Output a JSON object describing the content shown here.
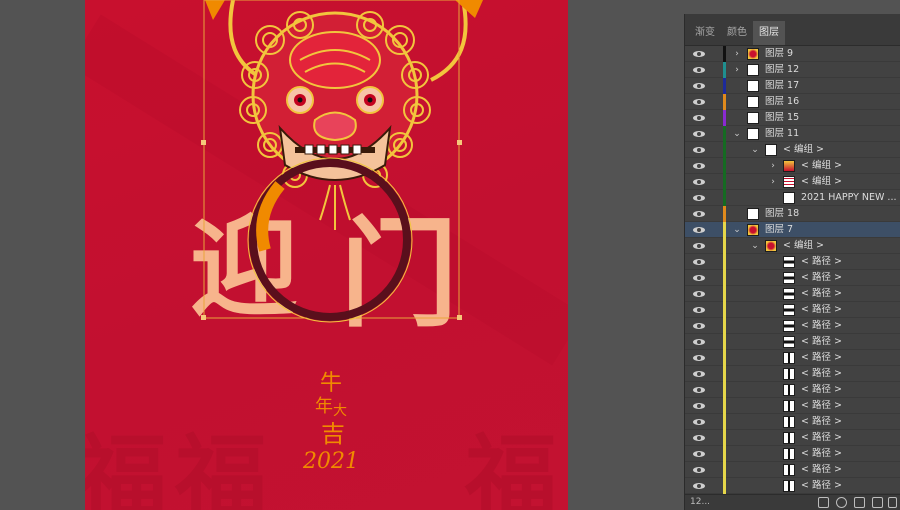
{
  "panel": {
    "tabs": [
      {
        "label": "渐变",
        "active": false
      },
      {
        "label": "颜色",
        "active": false
      },
      {
        "label": "图层",
        "active": true
      }
    ],
    "footer_count": "12..."
  },
  "layers": [
    {
      "name": "图层 9",
      "depth": 0,
      "twisty": "right",
      "color": "#111111",
      "thumb": "art",
      "selected": false
    },
    {
      "name": "图层 12",
      "depth": 0,
      "twisty": "right",
      "color": "#1f8f8f",
      "thumb": "blank",
      "selected": false
    },
    {
      "name": "图层 17",
      "depth": 0,
      "twisty": "",
      "color": "#1d2a9a",
      "thumb": "blank",
      "selected": false
    },
    {
      "name": "图层 16",
      "depth": 0,
      "twisty": "",
      "color": "#e08a1c",
      "thumb": "blank",
      "selected": false
    },
    {
      "name": "图层 15",
      "depth": 0,
      "twisty": "",
      "color": "#8a2ad0",
      "thumb": "blank",
      "selected": false
    },
    {
      "name": "图层 11",
      "depth": 0,
      "twisty": "down",
      "color": "#156b22",
      "thumb": "blank",
      "selected": false
    },
    {
      "name": "< 编组 >",
      "depth": 1,
      "twisty": "down",
      "color": "#156b22",
      "thumb": "blank",
      "selected": false
    },
    {
      "name": "< 编组 >",
      "depth": 2,
      "twisty": "right",
      "color": "#156b22",
      "thumb": "art2",
      "selected": false
    },
    {
      "name": "< 编组 >",
      "depth": 2,
      "twisty": "right",
      "color": "#156b22",
      "thumb": "art3",
      "selected": false
    },
    {
      "name": "2021 HAPPY NEW ...",
      "depth": 2,
      "twisty": "",
      "color": "#156b22",
      "thumb": "blank",
      "selected": false
    },
    {
      "name": "图层 18",
      "depth": 0,
      "twisty": "",
      "color": "#e08a1c",
      "thumb": "blank",
      "selected": false
    },
    {
      "name": "图层 7",
      "depth": 0,
      "twisty": "down",
      "color": "#e6d74a",
      "thumb": "art",
      "selected": true
    },
    {
      "name": "< 编组 >",
      "depth": 1,
      "twisty": "down",
      "color": "#e6d74a",
      "thumb": "art",
      "selected": false
    },
    {
      "name": "< 路径 >",
      "depth": 2,
      "twisty": "",
      "color": "#e6d74a",
      "thumb": "bar",
      "selected": false
    },
    {
      "name": "< 路径 >",
      "depth": 2,
      "twisty": "",
      "color": "#e6d74a",
      "thumb": "bar",
      "selected": false
    },
    {
      "name": "< 路径 >",
      "depth": 2,
      "twisty": "",
      "color": "#e6d74a",
      "thumb": "bar",
      "selected": false
    },
    {
      "name": "< 路径 >",
      "depth": 2,
      "twisty": "",
      "color": "#e6d74a",
      "thumb": "bar",
      "selected": false
    },
    {
      "name": "< 路径 >",
      "depth": 2,
      "twisty": "",
      "color": "#e6d74a",
      "thumb": "bar",
      "selected": false
    },
    {
      "name": "< 路径 >",
      "depth": 2,
      "twisty": "",
      "color": "#e6d74a",
      "thumb": "bar",
      "selected": false
    },
    {
      "name": "< 路径 >",
      "depth": 2,
      "twisty": "",
      "color": "#e6d74a",
      "thumb": "vbar",
      "selected": false
    },
    {
      "name": "< 路径 >",
      "depth": 2,
      "twisty": "",
      "color": "#e6d74a",
      "thumb": "vbar",
      "selected": false
    },
    {
      "name": "< 路径 >",
      "depth": 2,
      "twisty": "",
      "color": "#e6d74a",
      "thumb": "vbar",
      "selected": false
    },
    {
      "name": "< 路径 >",
      "depth": 2,
      "twisty": "",
      "color": "#e6d74a",
      "thumb": "vbar",
      "selected": false
    },
    {
      "name": "< 路径 >",
      "depth": 2,
      "twisty": "",
      "color": "#e6d74a",
      "thumb": "vbar",
      "selected": false
    },
    {
      "name": "< 路径 >",
      "depth": 2,
      "twisty": "",
      "color": "#e6d74a",
      "thumb": "vbar",
      "selected": false
    },
    {
      "name": "< 路径 >",
      "depth": 2,
      "twisty": "",
      "color": "#e6d74a",
      "thumb": "vbar",
      "selected": false
    },
    {
      "name": "< 路径 >",
      "depth": 2,
      "twisty": "",
      "color": "#e6d74a",
      "thumb": "vbar",
      "selected": false
    },
    {
      "name": "< 路径 >",
      "depth": 2,
      "twisty": "",
      "color": "#e6d74a",
      "thumb": "vbar",
      "selected": false
    }
  ],
  "artwork": {
    "big_chars": [
      "迎",
      "门"
    ],
    "blessing_lines": [
      "牛",
      "年",
      "大",
      "吉"
    ],
    "year": "2021",
    "fu_chars": [
      "福",
      "福",
      "福"
    ],
    "colors": {
      "background": "#c8102e",
      "char": "#f7b48c",
      "gold": "#f2c53d",
      "ring": "#5a0f1c",
      "year": "#f08a00"
    }
  }
}
